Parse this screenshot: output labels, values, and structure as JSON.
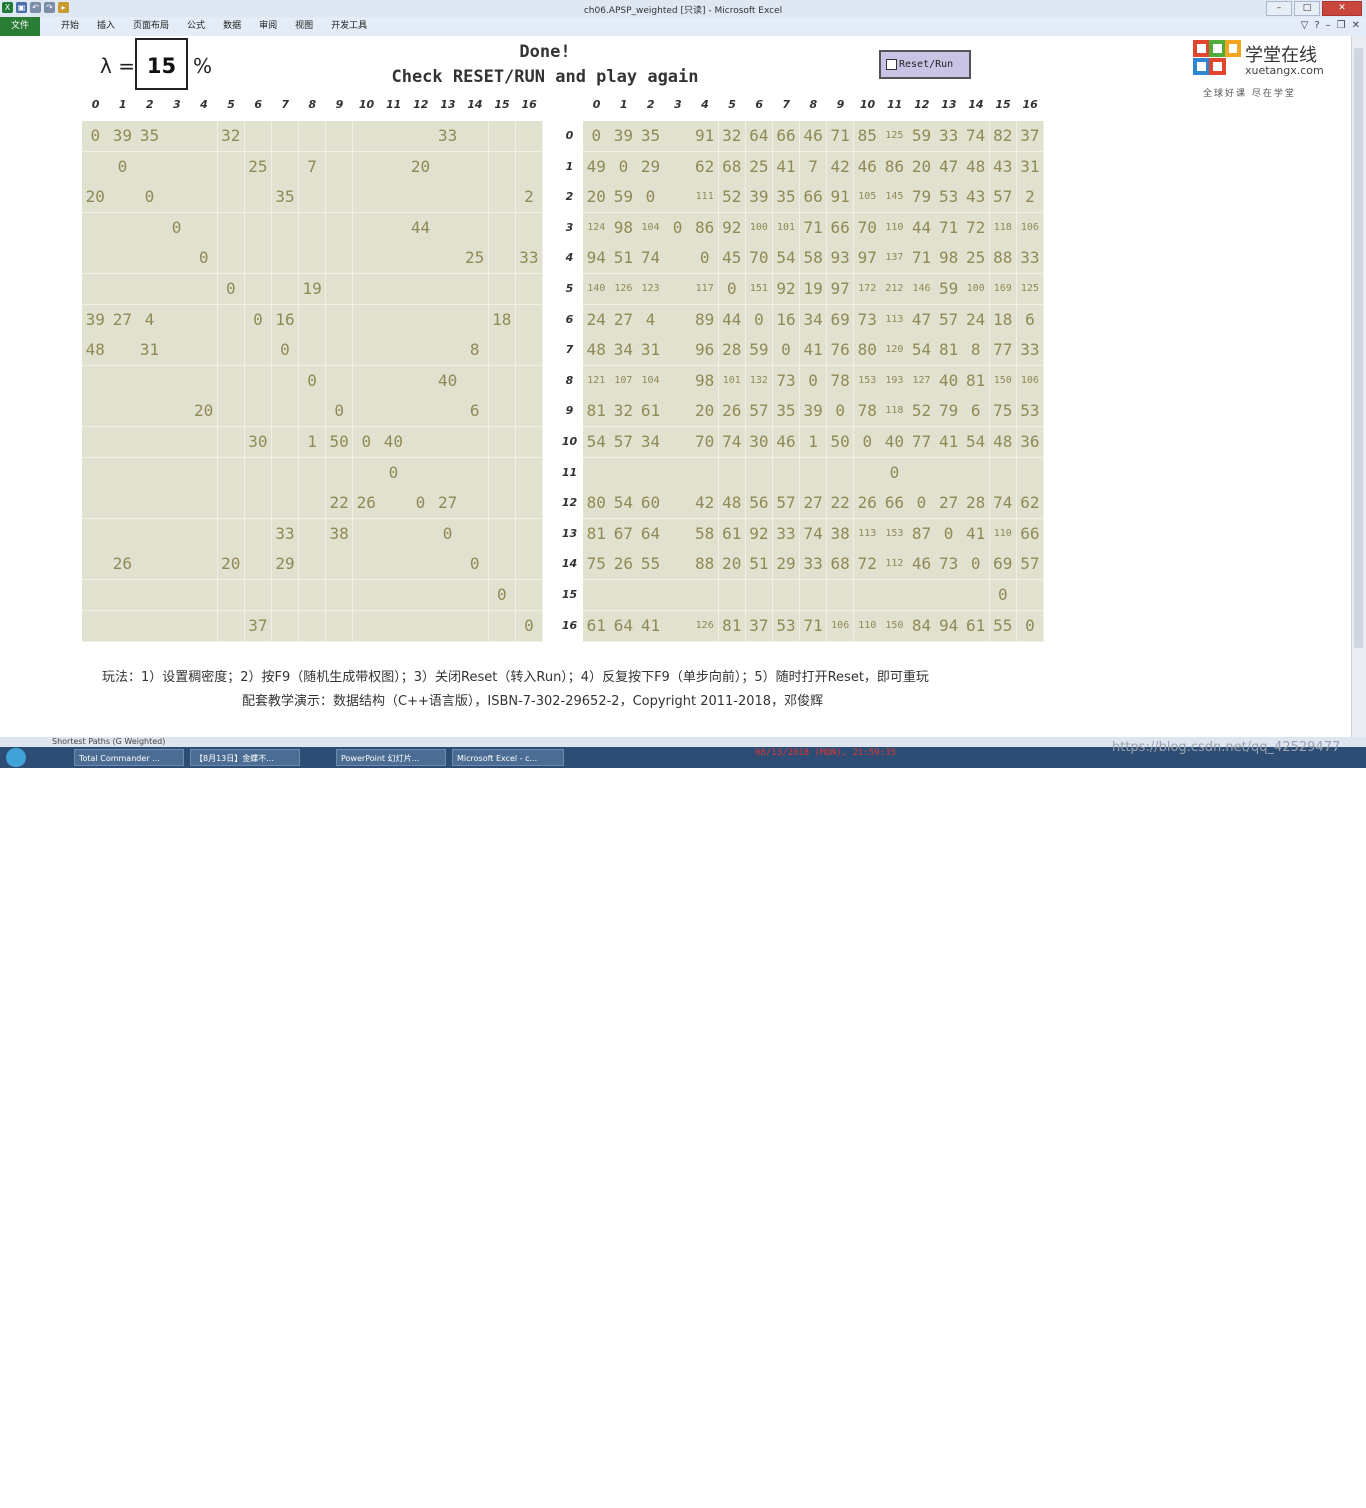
{
  "window": {
    "title": "ch06.APSP_weighted  [只读] - Microsoft Excel",
    "ribbon_file": "文件",
    "ribbon_tabs": [
      "开始",
      "插入",
      "页面布局",
      "公式",
      "数据",
      "审阅",
      "视图",
      "开发工具"
    ]
  },
  "sheet": {
    "lambda_symbol": "λ =",
    "lambda_value": "15",
    "percent": "%",
    "status_line1": "Done!",
    "status_line2": "Check RESET/RUN and play again",
    "reset_button_label": "Reset/Run",
    "logo_cn": "学堂在线",
    "logo_en": "xuetangx.com",
    "logo_slogan": "全球好课 尽在学堂",
    "column_headers": [
      "0",
      "1",
      "2",
      "3",
      "4",
      "5",
      "6",
      "7",
      "8",
      "9",
      "10",
      "11",
      "12",
      "13",
      "14",
      "15",
      "16"
    ],
    "row_headers": [
      "0",
      "1",
      "2",
      "3",
      "4",
      "5",
      "6",
      "7",
      "8",
      "9",
      "10",
      "11",
      "12",
      "13",
      "14",
      "15",
      "16"
    ],
    "weight_matrix": [
      [
        "0",
        "39",
        "35",
        "",
        "",
        "32",
        "",
        "",
        "",
        "",
        "",
        "",
        "",
        "33",
        "",
        "",
        ""
      ],
      [
        "",
        "0",
        "",
        "",
        "",
        "",
        "25",
        "",
        "7",
        "",
        "",
        "",
        "20",
        "",
        "",
        "",
        ""
      ],
      [
        "20",
        "",
        "0",
        "",
        "",
        "",
        "",
        "35",
        "",
        "",
        "",
        "",
        "",
        "",
        "",
        "",
        "2"
      ],
      [
        "",
        "",
        "",
        "0",
        "",
        "",
        "",
        "",
        "",
        "",
        "",
        "",
        "44",
        "",
        "",
        "",
        ""
      ],
      [
        "",
        "",
        "",
        "",
        "0",
        "",
        "",
        "",
        "",
        "",
        "",
        "",
        "",
        "",
        "25",
        "",
        "33"
      ],
      [
        "",
        "",
        "",
        "",
        "",
        "0",
        "",
        "",
        "19",
        "",
        "",
        "",
        "",
        "",
        "",
        "",
        ""
      ],
      [
        "39",
        "27",
        "4",
        "",
        "",
        "",
        "0",
        "16",
        "",
        "",
        "",
        "",
        "",
        "",
        "",
        "18",
        ""
      ],
      [
        "48",
        "",
        "31",
        "",
        "",
        "",
        "",
        "0",
        "",
        "",
        "",
        "",
        "",
        "",
        "8",
        "",
        ""
      ],
      [
        "",
        "",
        "",
        "",
        "",
        "",
        "",
        "",
        "0",
        "",
        "",
        "",
        "",
        "40",
        "",
        "",
        ""
      ],
      [
        "",
        "",
        "",
        "",
        "20",
        "",
        "",
        "",
        "",
        "0",
        "",
        "",
        "",
        "",
        "6",
        "",
        ""
      ],
      [
        "",
        "",
        "",
        "",
        "",
        "",
        "30",
        "",
        "1",
        "50",
        "0",
        "40",
        "",
        "",
        "",
        "",
        ""
      ],
      [
        "",
        "",
        "",
        "",
        "",
        "",
        "",
        "",
        "",
        "",
        "",
        "0",
        "",
        "",
        "",
        "",
        ""
      ],
      [
        "",
        "",
        "",
        "",
        "",
        "",
        "",
        "",
        "",
        "22",
        "26",
        "",
        "0",
        "27",
        "",
        "",
        ""
      ],
      [
        "",
        "",
        "",
        "",
        "",
        "",
        "",
        "33",
        "",
        "38",
        "",
        "",
        "",
        "0",
        "",
        "",
        ""
      ],
      [
        "",
        "26",
        "",
        "",
        "",
        "20",
        "",
        "29",
        "",
        "",
        "",
        "",
        "",
        "",
        "0",
        "",
        ""
      ],
      [
        "",
        "",
        "",
        "",
        "",
        "",
        "",
        "",
        "",
        "",
        "",
        "",
        "",
        "",
        "",
        "0",
        ""
      ],
      [
        "",
        "",
        "",
        "",
        "",
        "",
        "37",
        "",
        "",
        "",
        "",
        "",
        "",
        "",
        "",
        "",
        "0"
      ]
    ],
    "distance_matrix": [
      [
        "0",
        "39",
        "35",
        "",
        "91",
        "32",
        "64",
        "66",
        "46",
        "71",
        "85",
        "125",
        "59",
        "33",
        "74",
        "82",
        "37"
      ],
      [
        "49",
        "0",
        "29",
        "",
        "62",
        "68",
        "25",
        "41",
        "7",
        "42",
        "46",
        "86",
        "20",
        "47",
        "48",
        "43",
        "31"
      ],
      [
        "20",
        "59",
        "0",
        "",
        "111",
        "52",
        "39",
        "35",
        "66",
        "91",
        "105",
        "145",
        "79",
        "53",
        "43",
        "57",
        "2"
      ],
      [
        "124",
        "98",
        "104",
        "0",
        "86",
        "92",
        "100",
        "101",
        "71",
        "66",
        "70",
        "110",
        "44",
        "71",
        "72",
        "118",
        "106"
      ],
      [
        "94",
        "51",
        "74",
        "",
        "0",
        "45",
        "70",
        "54",
        "58",
        "93",
        "97",
        "137",
        "71",
        "98",
        "25",
        "88",
        "33"
      ],
      [
        "140",
        "126",
        "123",
        "",
        "117",
        "0",
        "151",
        "92",
        "19",
        "97",
        "172",
        "212",
        "146",
        "59",
        "100",
        "169",
        "125"
      ],
      [
        "24",
        "27",
        "4",
        "",
        "89",
        "44",
        "0",
        "16",
        "34",
        "69",
        "73",
        "113",
        "47",
        "57",
        "24",
        "18",
        "6"
      ],
      [
        "48",
        "34",
        "31",
        "",
        "96",
        "28",
        "59",
        "0",
        "41",
        "76",
        "80",
        "120",
        "54",
        "81",
        "8",
        "77",
        "33"
      ],
      [
        "121",
        "107",
        "104",
        "",
        "98",
        "101",
        "132",
        "73",
        "0",
        "78",
        "153",
        "193",
        "127",
        "40",
        "81",
        "150",
        "106"
      ],
      [
        "81",
        "32",
        "61",
        "",
        "20",
        "26",
        "57",
        "35",
        "39",
        "0",
        "78",
        "118",
        "52",
        "79",
        "6",
        "75",
        "53"
      ],
      [
        "54",
        "57",
        "34",
        "",
        "70",
        "74",
        "30",
        "46",
        "1",
        "50",
        "0",
        "40",
        "77",
        "41",
        "54",
        "48",
        "36"
      ],
      [
        "",
        "",
        "",
        "",
        "",
        "",
        "",
        "",
        "",
        "",
        "",
        "0",
        "",
        "",
        "",
        "",
        ""
      ],
      [
        "80",
        "54",
        "60",
        "",
        "42",
        "48",
        "56",
        "57",
        "27",
        "22",
        "26",
        "66",
        "0",
        "27",
        "28",
        "74",
        "62"
      ],
      [
        "81",
        "67",
        "64",
        "",
        "58",
        "61",
        "92",
        "33",
        "74",
        "38",
        "113",
        "153",
        "87",
        "0",
        "41",
        "110",
        "66"
      ],
      [
        "75",
        "26",
        "55",
        "",
        "88",
        "20",
        "51",
        "29",
        "33",
        "68",
        "72",
        "112",
        "46",
        "73",
        "0",
        "69",
        "57"
      ],
      [
        "",
        "",
        "",
        "",
        "",
        "",
        "",
        "",
        "",
        "",
        "",
        "",
        "",
        "",
        "",
        "0",
        ""
      ],
      [
        "61",
        "64",
        "41",
        "",
        "126",
        "81",
        "37",
        "53",
        "71",
        "106",
        "110",
        "150",
        "84",
        "94",
        "61",
        "55",
        "0"
      ]
    ],
    "footer_line1": "玩法：1）设置稠密度；2）按F9（随机生成带权图）；3）关闭Reset（转入Run）；4）反复按下F9（单步向前）；5）随时打开Reset，即可重玩",
    "footer_line2": "配套教学演示：数据结构（C++语言版），ISBN-7-302-29652-2，Copyright 2011-2018，邓俊辉"
  },
  "sheet_tab": "Shortest Paths (G Weighted)",
  "taskbar": {
    "buttons": [
      "Total Commander ...",
      "【8月13日】金蝶不...",
      "PowerPoint 幻灯片...",
      "Microsoft Excel - c..."
    ],
    "datestamp": "08/13/2018 (MON), 21:59:35",
    "watermark": "https://blog.csdn.net/qq_42529477",
    "clock": "21:59"
  },
  "colors": {
    "cell_bg": "#e1e1d0",
    "cell_text": "#8f8a55",
    "excel_green": "#2a7d35",
    "taskbar": "#2d4d74"
  }
}
